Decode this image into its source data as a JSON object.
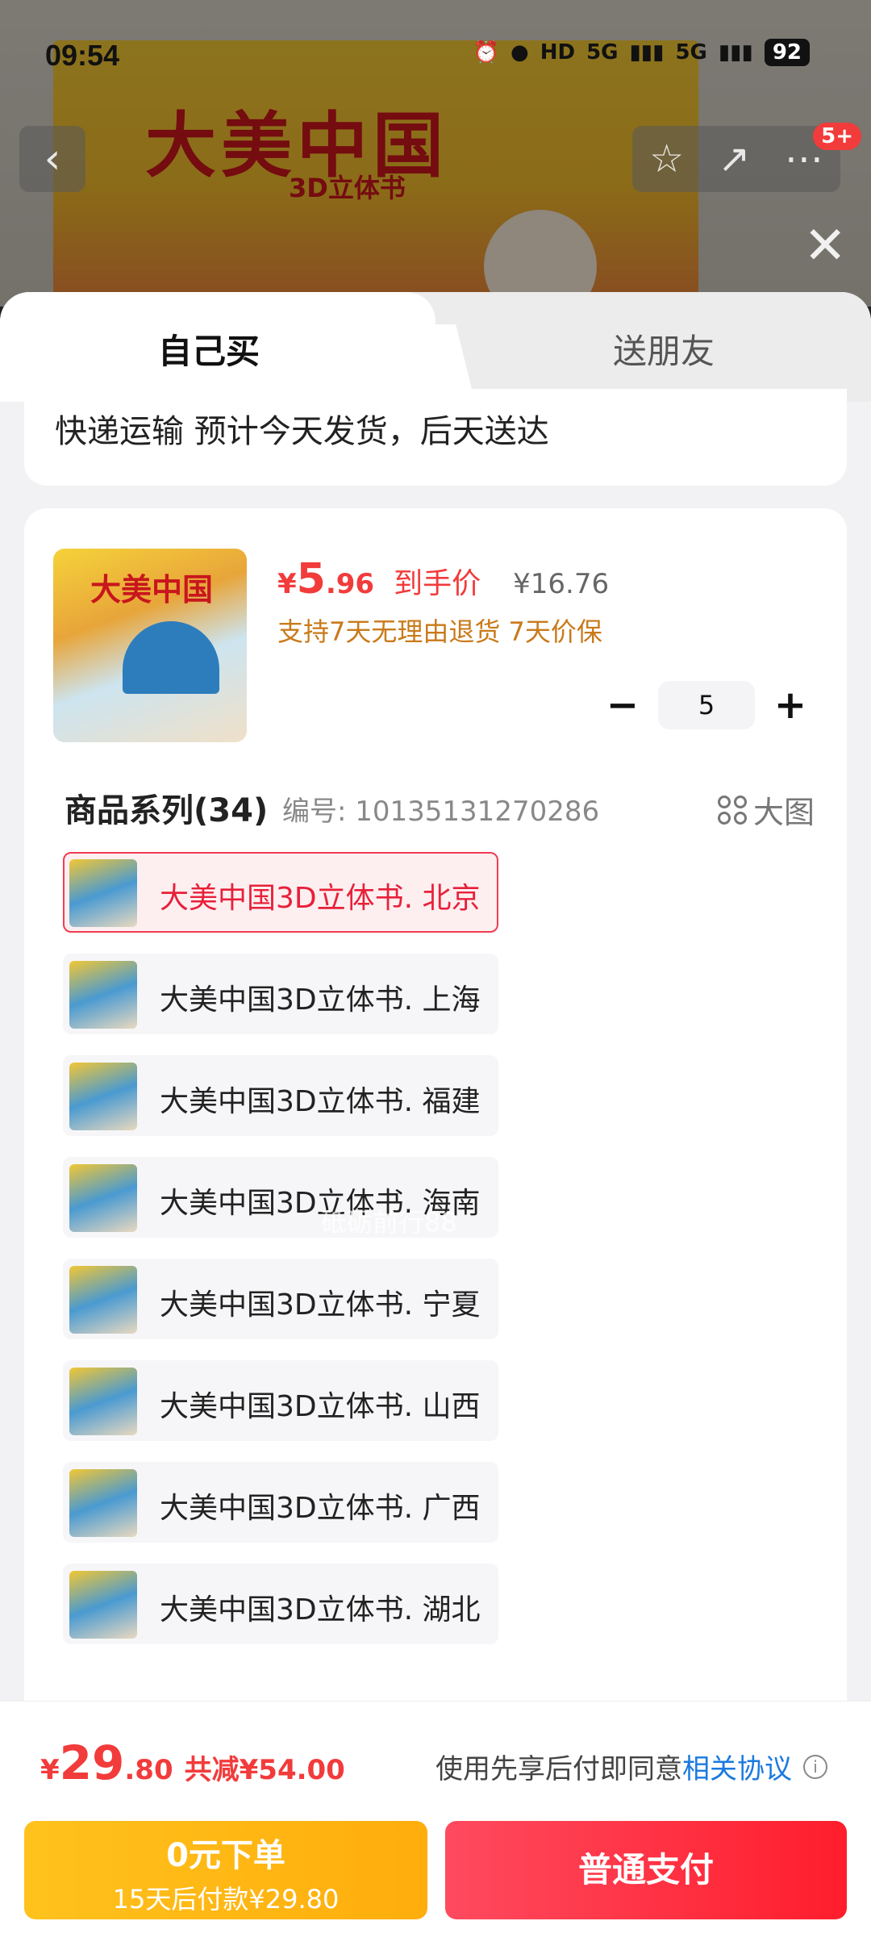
{
  "status_bar": {
    "time": "09:54",
    "network_hd": "HD",
    "net1": "5G",
    "net2": "5G",
    "battery": "92"
  },
  "background": {
    "banner_title": "大美中国",
    "banner_sub": "3D立体书",
    "badge": "5+"
  },
  "tabs": {
    "self": "自己买",
    "friend": "送朋友"
  },
  "shipping": {
    "text": "快递运输 预计今天发货，后天送达"
  },
  "product": {
    "thumb_title": "大美中国",
    "currency": "¥",
    "price_int": "5",
    "price_dec": ".96",
    "price_tag": "到手价",
    "original_price": "¥16.76",
    "guarantee": "支持7天无理由退货 7天价保",
    "quantity": "5",
    "minus": "−",
    "plus": "+"
  },
  "series": {
    "title": "商品系列(34)",
    "code": "编号: 10135131270286",
    "big_view": "大图",
    "items": [
      {
        "label": "大美中国3D立体书. 北京",
        "selected": true
      },
      {
        "label": "大美中国3D立体书. 上海",
        "selected": false
      },
      {
        "label": "大美中国3D立体书. 福建",
        "selected": false
      },
      {
        "label": "大美中国3D立体书. 海南",
        "selected": false
      },
      {
        "label": "大美中国3D立体书. 宁夏",
        "selected": false
      },
      {
        "label": "大美中国3D立体书. 山西",
        "selected": false
      },
      {
        "label": "大美中国3D立体书. 广西",
        "selected": false
      },
      {
        "label": "大美中国3D立体书. 湖北",
        "selected": false
      }
    ],
    "watermark": "砥砺前行88"
  },
  "footer": {
    "currency": "¥",
    "total_int": "29",
    "total_dec": ".80",
    "saving": "共减¥54.00",
    "agree_prefix": "使用先享后付即同意",
    "agree_link": "相关协议",
    "zero_btn_line1": "0元下单",
    "zero_btn_line2": "15天后付款¥29.80",
    "pay_btn": "普通支付"
  },
  "colors": {
    "accent_red": "#f23b3b",
    "link_blue": "#1a7ae0",
    "gold": "#ffb514"
  }
}
